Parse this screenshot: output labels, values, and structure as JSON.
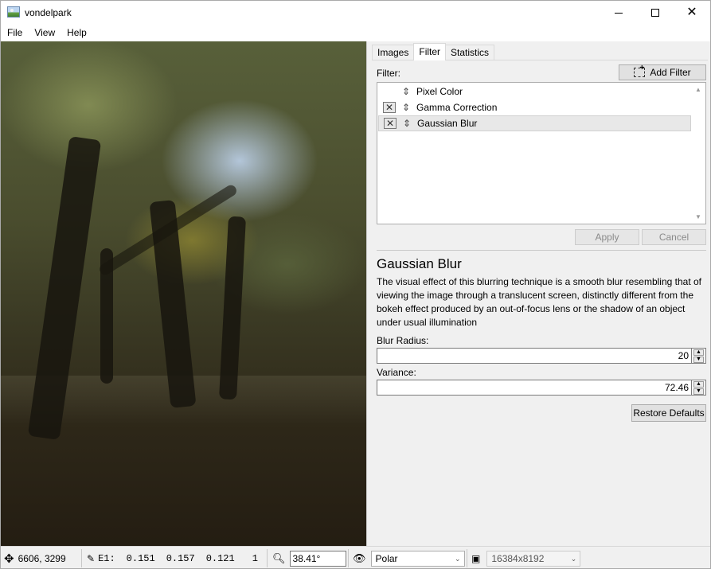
{
  "window": {
    "title": "vondelpark"
  },
  "menu": [
    {
      "label": "File"
    },
    {
      "label": "View"
    },
    {
      "label": "Help"
    }
  ],
  "tabs": [
    {
      "label": "Images"
    },
    {
      "label": "Filter",
      "active": true
    },
    {
      "label": "Statistics"
    }
  ],
  "filter": {
    "label": "Filter:",
    "add_button": "Add Filter",
    "items": [
      {
        "label": "Pixel Color",
        "checked": false
      },
      {
        "label": "Gamma Correction",
        "checked": true
      },
      {
        "label": "Gaussian Blur",
        "checked": true,
        "selected": true
      }
    ],
    "apply_button": "Apply",
    "cancel_button": "Cancel"
  },
  "details": {
    "title": "Gaussian Blur",
    "description": "The visual effect of this blurring technique is a smooth blur resembling that of viewing the image through a translucent screen, distinctly different from the bokeh effect produced by an out-of-focus lens or the shadow of an object under usual illumination",
    "blur_radius_label": "Blur Radius:",
    "blur_radius_value": "20",
    "variance_label": "Variance:",
    "variance_value": "72.46",
    "restore_button": "Restore Defaults"
  },
  "status": {
    "position": "6606, 3299",
    "pixel_label": "E1:",
    "pixel_r": "0.151",
    "pixel_g": "0.157",
    "pixel_b": "0.121",
    "pixel_a": "1",
    "zoom": "38.41°",
    "projection": "Polar",
    "resolution": "16384x8192"
  },
  "icons": {
    "app": "image-icon",
    "move": "move-icon",
    "picker": "eyedropper-icon",
    "zoom": "magnifier-icon",
    "view": "eye-icon",
    "resolution": "image-size-icon"
  },
  "colors": {
    "accent_selection": "#e8e8e8",
    "panel_bg": "#f0f0f0"
  }
}
